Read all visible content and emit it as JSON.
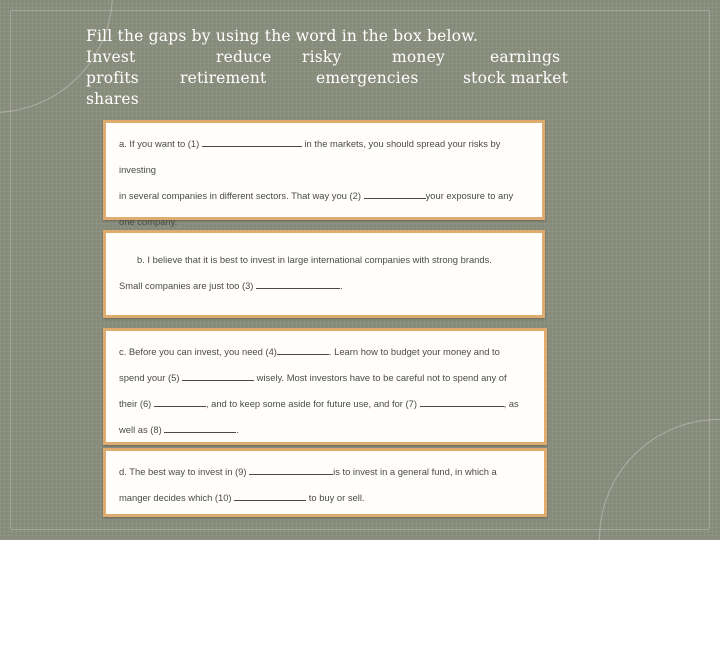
{
  "slide": {
    "background_color": "#878b7a",
    "accent_border_color": "#e0ab6e",
    "card_background_color": "#fffefb",
    "heading_text_color": "#ffffff",
    "body_text_color": "#4a4a4a"
  },
  "heading": {
    "instruction": "Fill the gaps by using the word in the box below."
  },
  "word_bank": {
    "row1": [
      "Invest",
      "reduce",
      "risky",
      "money",
      "earnings"
    ],
    "row2": [
      "profits",
      "retirement",
      "emergencies",
      "stock market"
    ],
    "row3": [
      "shares"
    ]
  },
  "questions": [
    {
      "id": "a",
      "label": "a.",
      "lines": [
        {
          "before": "a. If you want to (1)",
          "after": "in the markets, you should spread your risks by investing"
        },
        {
          "before": "in several companies in different sectors. That way you  (2)",
          "after": "your exposure to any"
        },
        {
          "before": "one company.",
          "after": ""
        }
      ]
    },
    {
      "id": "b",
      "label": "b.",
      "lines": [
        {
          "before": "b. I believe that it is best to invest in large international companies with strong brands.",
          "after": ""
        },
        {
          "before": "Small companies are just too (3)",
          "after": "."
        }
      ]
    },
    {
      "id": "c",
      "label": "c.",
      "lines": [
        {
          "before": "c. Before you can invest, you need (4)",
          "after": ". Learn how to budget your money and to"
        },
        {
          "before": "spend your (5)",
          "after": "wisely. Most investors have to be careful not to spend any of"
        },
        {
          "before": "their (6)",
          "after": ", and to keep some aside for future use, and for (7)"
        },
        {
          "before": "well as (8)",
          "after": "."
        }
      ]
    },
    {
      "id": "d",
      "label": "d.",
      "lines": [
        {
          "before": "d. The best way to invest in (9)",
          "after": "is to invest in a general fund, in which a"
        },
        {
          "before": "manger decides which (10)",
          "after": "to buy or sell."
        }
      ]
    }
  ],
  "fragments": {
    "c_line3_tail": ", as"
  }
}
